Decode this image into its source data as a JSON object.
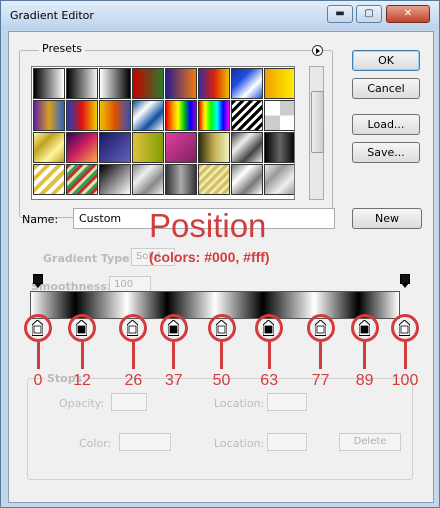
{
  "window": {
    "title": "Gradient Editor",
    "minimize_glyph": "▬",
    "maximize_glyph": "▢",
    "close_glyph": "✕"
  },
  "presets": {
    "label": "Presets",
    "menu_icon": "flyout-menu-icon",
    "swatches": [
      "linear-gradient(90deg,#000,#fff)",
      "linear-gradient(90deg,#000,rgba(0,0,0,0.05))",
      "linear-gradient(90deg,#fff,#000)",
      "linear-gradient(90deg,#c00,#2a7a2a)",
      "linear-gradient(90deg,#2b1b8f,#f07a10)",
      "linear-gradient(90deg,#3a2aa0,#d8200a,#f0c000)",
      "linear-gradient(135deg,#1430a0,#2050e0,#fff,#2050e0)",
      "linear-gradient(90deg,#f0a000,#fff000)",
      "linear-gradient(90deg,#6020a0,#d8a020,#3060c0)",
      "linear-gradient(90deg,#1a40c0,#e01010,#f0d000)",
      "linear-gradient(90deg,#f0c000,#e05000,#3050c0)",
      "linear-gradient(135deg,#1050a0,#fff,#1050a0,#fff)",
      "linear-gradient(90deg,#e00,#f80,#ff0,#0c0,#00f,#90c)",
      "linear-gradient(90deg,#f00,#ff0,#0f0,#0ff,#00f,#f0f)",
      "repeating-linear-gradient(135deg,#000 0 3px,#fff 3px 6px)",
      "repeating-conic-gradient(#ccc 0 25%,#fff 0 50%)",
      "linear-gradient(135deg,#fff6a0,#c0a020,#fff6a0,#c0a020)",
      "linear-gradient(135deg,#300060,#d02060,#f0b040)",
      "linear-gradient(135deg,#1a1a60,#6060c0)",
      "linear-gradient(90deg,#e0c040,#80a000)",
      "linear-gradient(135deg,#e040a0,#802060)",
      "linear-gradient(90deg,#302a10,#c0b050,#f0f0c0)",
      "linear-gradient(135deg,#444,#eee,#444,#eee)",
      "linear-gradient(90deg,#000,#666,#000)",
      "repeating-linear-gradient(135deg,#e0c040 0 4px,#fff 4px 8px)",
      "repeating-linear-gradient(135deg,#c03030 0 3px,#e0e0a0 3px 6px,#30a060 6px 9px)",
      "linear-gradient(135deg,#000,#fff)",
      "linear-gradient(135deg,#888,#eee,#888,#eee)",
      "linear-gradient(90deg,#333,#aaa,#333)",
      "repeating-linear-gradient(135deg,#d0c060 0 3px,#f0e8b0 3px 6px)",
      "linear-gradient(135deg,#777,#fff,#777,#fff)",
      "linear-gradient(135deg,#eee,#999,#eee,#999)"
    ]
  },
  "buttons": {
    "ok": "OK",
    "cancel": "Cancel",
    "load": "Load...",
    "save": "Save...",
    "new": "New"
  },
  "name_field": {
    "label": "Name:",
    "value": "Custom"
  },
  "faded_panel": {
    "gradient_type_label": "Gradient Type:",
    "gradient_type_value": "Solid",
    "smoothness_label": "Smoothness:",
    "smoothness_value": "100",
    "stops_label": "Stops",
    "opacity_label": "Opacity:",
    "location_label": "Location:",
    "color_label": "Color:",
    "delete_label": "Delete"
  },
  "gradient": {
    "css": "linear-gradient(90deg,#fff 0%,#000 12%,#fff 26%,#000 37%,#fff 50%,#000 63%,#fff 77%,#000 89%,#fff 100%)",
    "opacity_stops": [
      0,
      100
    ]
  },
  "annotation": {
    "title": "Position",
    "subtitle": "(colors: #000, #fff)",
    "color": "#d33c3c",
    "stops": [
      {
        "label": "0",
        "position": 0,
        "color": "#fff"
      },
      {
        "label": "12",
        "position": 12,
        "color": "#000"
      },
      {
        "label": "26",
        "position": 26,
        "color": "#fff"
      },
      {
        "label": "37",
        "position": 37,
        "color": "#000"
      },
      {
        "label": "50",
        "position": 50,
        "color": "#fff"
      },
      {
        "label": "63",
        "position": 63,
        "color": "#000"
      },
      {
        "label": "77",
        "position": 77,
        "color": "#fff"
      },
      {
        "label": "89",
        "position": 89,
        "color": "#000"
      },
      {
        "label": "100",
        "position": 100,
        "color": "#fff"
      }
    ]
  }
}
